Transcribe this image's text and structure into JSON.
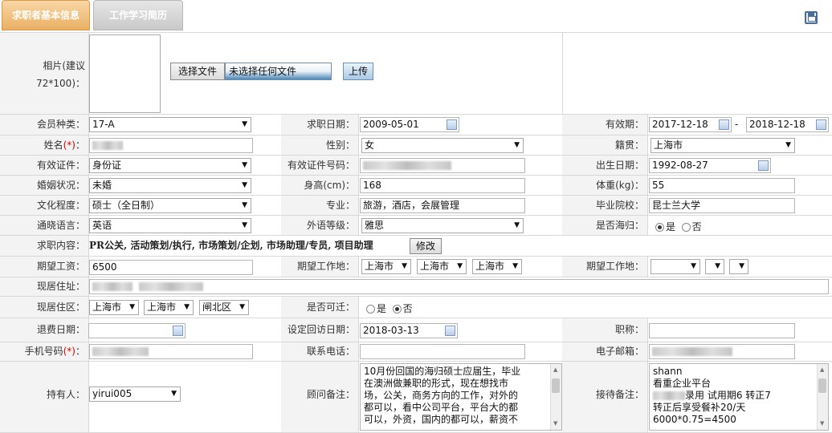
{
  "tabs": [
    {
      "label": "求职者基本信息"
    },
    {
      "label": "工作学习简历"
    }
  ],
  "photo": {
    "label": "相片(建议72*100)：",
    "choose_label": "选择文件",
    "file_status": "未选择任何文件",
    "upload_label": "上传"
  },
  "member_type": {
    "label": "会员种类：",
    "value": "17-A"
  },
  "apply_date": {
    "label": "求职日期：",
    "value": "2009-05-01"
  },
  "validity": {
    "label": "有效期：",
    "start": "2017-12-18",
    "sep": "-",
    "end": "2018-12-18"
  },
  "name": {
    "label": "姓名",
    "req": "(*)",
    "colon": "："
  },
  "gender": {
    "label": "性别：",
    "value": "女"
  },
  "native": {
    "label": "籍贯：",
    "value": "上海市"
  },
  "id_type": {
    "label": "有效证件：",
    "value": "身份证"
  },
  "id_number": {
    "label": "有效证件号码："
  },
  "birth": {
    "label": "出生日期：",
    "value": "1992-08-27"
  },
  "marital": {
    "label": "婚姻状况：",
    "value": "未婚"
  },
  "height": {
    "label": "身高(cm)：",
    "value": "168"
  },
  "weight": {
    "label": "体重(kg)：",
    "value": "55"
  },
  "education": {
    "label": "文化程度：",
    "value": "硕士（全日制）"
  },
  "major": {
    "label": "专业：",
    "value": "旅游，酒店，会展管理"
  },
  "school": {
    "label": "毕业院校：",
    "value": "昆士兰大学"
  },
  "language": {
    "label": "通晓语言：",
    "value": "英语"
  },
  "foreign_level": {
    "label": "外语等级：",
    "value": "雅思"
  },
  "returnee": {
    "label": "是否海归：",
    "yes": "是",
    "no": "否"
  },
  "job_content": {
    "label": "求职内容：",
    "value": "PR公关, 活动策划/执行, 市场策划/企划, 市场助理/专员, 项目助理",
    "edit_label": "修改"
  },
  "salary": {
    "label": "期望工资：",
    "value": "6500"
  },
  "work_place1": {
    "label": "期望工作地：",
    "v1": "上海市",
    "v2": "上海市",
    "v3": "上海市"
  },
  "work_place2": {
    "label": "期望工作地："
  },
  "address": {
    "label": "现居住址："
  },
  "district": {
    "label": "现居住区：",
    "v1": "上海市",
    "v2": "上海市",
    "v3": "闸北区"
  },
  "relocate": {
    "label": "是否可迁：",
    "yes": "是",
    "no": "否"
  },
  "refund": {
    "label": "退费日期："
  },
  "visit_date": {
    "label": "设定回访日期：",
    "value": "2018-03-13"
  },
  "title_field": {
    "label": "职称："
  },
  "mobile": {
    "label": "手机号码",
    "req": "(*)",
    "colon": "："
  },
  "phone": {
    "label": "联系电话："
  },
  "email": {
    "label": "电子邮箱："
  },
  "owner": {
    "label": "持有人：",
    "value": "yirui005"
  },
  "consultant_note": {
    "label": "顾问备注：",
    "lines": [
      "10月份回国的海归硕士应届生，毕业",
      "在澳洲做兼职的形式，现在想找市",
      "场，公关，商务方向的工作，对外的",
      "都可以，看中公司平台，平台大的都",
      "可以，外资，国内的都可以，薪资不"
    ]
  },
  "reception_note": {
    "label": "接待备注：",
    "lines": [
      "shann",
      "看重企业平台",
      "录用  试用期6  转正7",
      "转正后享受餐补20/天",
      "6000*0.75=4500"
    ]
  }
}
